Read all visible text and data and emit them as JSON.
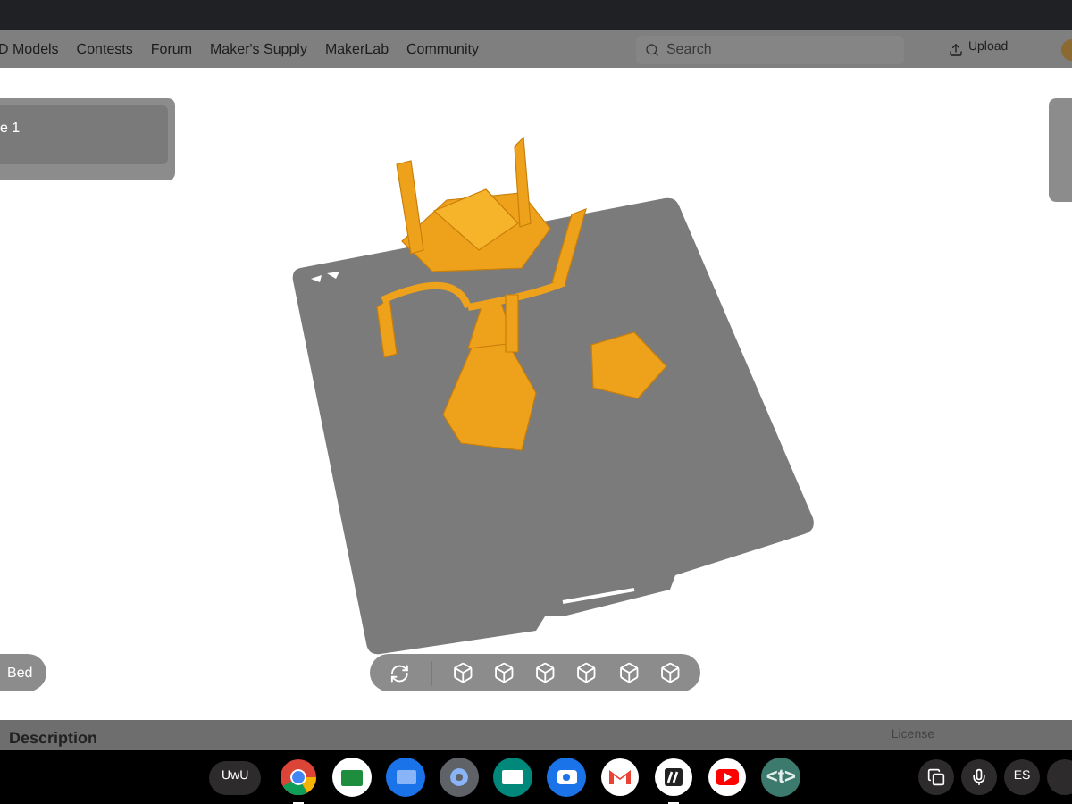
{
  "top_nav": {
    "links": [
      "D Models",
      "Contests",
      "Forum",
      "Maker's Supply",
      "MakerLab",
      "Community"
    ],
    "search": {
      "placeholder": "Search"
    },
    "upload": "Upload"
  },
  "object_panel": {
    "item": "e 1"
  },
  "viewer": {
    "bed_button": "Bed"
  },
  "page_sections": {
    "description": "Description",
    "license": "License"
  },
  "taskbar": {
    "launcher": "UwU",
    "apps": [
      {
        "kind": "browser",
        "running": true
      },
      {
        "kind": "board",
        "running": false
      },
      {
        "kind": "folder",
        "running": false
      },
      {
        "kind": "gear",
        "running": false
      },
      {
        "kind": "card",
        "running": false
      },
      {
        "kind": "camera",
        "running": false
      },
      {
        "kind": "mail",
        "running": false
      },
      {
        "kind": "stripes",
        "running": true
      },
      {
        "kind": "play",
        "running": false
      },
      {
        "kind": "text",
        "label": "<t>",
        "running": false
      }
    ],
    "language": "ES"
  }
}
